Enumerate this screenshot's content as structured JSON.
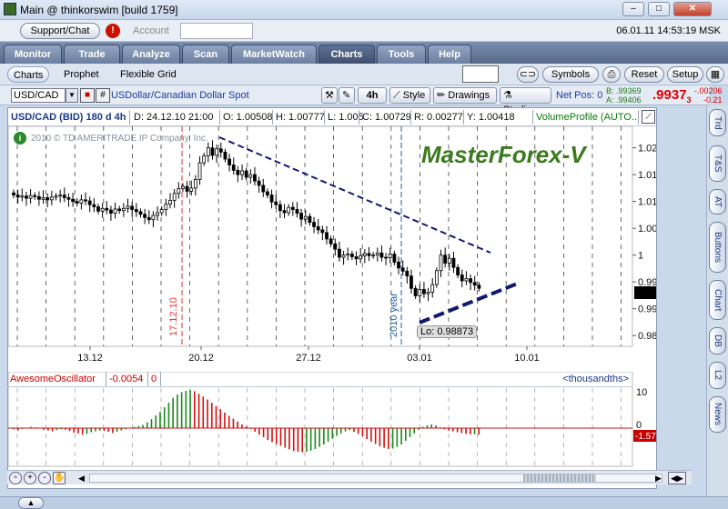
{
  "window": {
    "title": "Main @ thinkorswim [build 1759]",
    "minimize": "–",
    "maximize": "□",
    "close": "✕"
  },
  "toolbar": {
    "support_label": "Support/Chat",
    "alert_glyph": "!",
    "account_label": "Account",
    "account_value": "",
    "datetime": "06.01.11 14:53:19 MSK"
  },
  "main_tabs": [
    {
      "label": "Monitor"
    },
    {
      "label": "Trade"
    },
    {
      "label": "Analyze"
    },
    {
      "label": "Scan"
    },
    {
      "label": "MarketWatch"
    },
    {
      "label": "Charts",
      "active": true
    },
    {
      "label": "Tools"
    },
    {
      "label": "Help"
    }
  ],
  "sub_tabs": [
    {
      "label": "Charts",
      "active": true
    },
    {
      "label": "Prophet"
    },
    {
      "label": "Flexible Grid"
    }
  ],
  "sub_right": {
    "symbols": "Symbols",
    "reset": "Reset",
    "setup": "Setup"
  },
  "symbol_row": {
    "symbol": "USD/CAD",
    "hash": "#",
    "description": "USDollar/Canadian Dollar Spot",
    "timeframe": "4h",
    "style": "Style",
    "drawings": "Drawings",
    "studies": "Studies",
    "net_pos": "Net Pos: 0",
    "bid": "B: .99369",
    "ask": "A: .99406",
    "price": ".9937",
    "price_fraction": "3",
    "change_abs": "-.00206",
    "change_pct": "-0.21 %"
  },
  "chart_info": {
    "symbol": "USD/CAD (BID) 180 d 4h",
    "date": "D: 24.12.10 21:00",
    "open": "O: 1.00508",
    "high": "H: 1.00777",
    "low": "L: 1.005",
    "close": "C: 1.00729",
    "range": "R: 0.00277",
    "y": "Y: 1.00418",
    "volume_profile": "VolumeProfile (AUTO..."
  },
  "chart_overlay": {
    "copyright": "2010 © TD AMERITRADE IP Company, Inc.",
    "watermark": "MasterForex-V",
    "low_label": "Lo: 0.98873",
    "marker_1712": "17.12.10",
    "marker_year": "2010 year"
  },
  "right_tabs": [
    {
      "label": "Trd"
    },
    {
      "label": "T&S"
    },
    {
      "label": "AT"
    },
    {
      "label": "Buttons"
    },
    {
      "label": "Chart"
    },
    {
      "label": "DB"
    },
    {
      "label": "L2"
    },
    {
      "label": "News"
    }
  ],
  "oscillator": {
    "name": "AwesomeOscillator",
    "value": "-0.0054",
    "zero": "0",
    "units": "<thousandths>",
    "axis_top": "10",
    "axis_zero": "0",
    "current": "-1.5797"
  },
  "colors": {
    "bull": "#1a8a1a",
    "bear": "#d21010",
    "trend": "#101870",
    "marker": "#e03030",
    "yearline": "#2060a0"
  },
  "chart_data": {
    "type": "candlestick",
    "x_ticks": [
      "13.12",
      "20.12",
      "27.12",
      "03.01",
      "10.01"
    ],
    "y_ticks": [
      "1.02",
      "1.015",
      "1.01",
      "1.005",
      "1",
      "0.995",
      "0.99",
      "0.985"
    ],
    "ylim": [
      0.983,
      1.024
    ],
    "close_series": [
      1.0112,
      1.0108,
      1.011,
      1.0106,
      1.0111,
      1.0109,
      1.0104,
      1.0107,
      1.0103,
      1.0108,
      1.011,
      1.0112,
      1.0107,
      1.0104,
      1.01,
      1.0097,
      1.0103,
      1.0101,
      1.0094,
      1.009,
      1.0082,
      1.0087,
      1.0084,
      1.0078,
      1.0086,
      1.0083,
      1.0087,
      1.0091,
      1.0085,
      1.0081,
      1.0076,
      1.007,
      1.0066,
      1.0074,
      1.0079,
      1.0085,
      1.0095,
      1.0102,
      1.0115,
      1.0124,
      1.0128,
      1.0119,
      1.0125,
      1.0141,
      1.0172,
      1.0185,
      1.02,
      1.0186,
      1.0198,
      1.0192,
      1.0179,
      1.0168,
      1.0158,
      1.015,
      1.0157,
      1.0145,
      1.015,
      1.0138,
      1.013,
      1.0118,
      1.0112,
      1.0099,
      1.0094,
      1.0083,
      1.0079,
      1.0089,
      1.0085,
      1.0078,
      1.0067,
      1.0072,
      1.0061,
      1.0053,
      1.0047,
      1.0042,
      1.003,
      1.0021,
      1.0011,
      0.9996,
      1.0,
      1.0002,
      0.9997,
      0.9993,
      0.9999,
      1.0003,
      0.9999,
      1.0,
      1.0004,
      0.9996,
      0.9995,
      1.0002,
      0.9987,
      0.9976,
      0.997,
      0.9961,
      0.9938,
      0.9924,
      0.9936,
      0.9928,
      0.9931,
      0.9945,
      0.9971,
      1.0,
      0.9985,
      0.9994,
      0.9977,
      0.9963,
      0.9952,
      0.9956,
      0.9949,
      0.9944,
      0.9938
    ],
    "ao_values": [
      -0.3,
      -0.6,
      -0.2,
      0.1,
      0.3,
      0.2,
      -0.1,
      -0.4,
      -0.6,
      -0.8,
      -0.5,
      -0.3,
      -0.4,
      -0.7,
      -1.1,
      -1.3,
      -1.6,
      -1.4,
      -1.0,
      -0.8,
      -0.6,
      -0.7,
      -0.9,
      -1.2,
      -0.9,
      -0.6,
      -0.3,
      0.1,
      0.3,
      0.5,
      0.8,
      1.4,
      2.2,
      3.1,
      4.0,
      5.1,
      6.2,
      7.4,
      8.2,
      8.8,
      9.1,
      9.3,
      9.0,
      8.4,
      7.7,
      7.0,
      6.2,
      5.4,
      4.6,
      3.8,
      3.0,
      2.3,
      1.6,
      0.9,
      0.4,
      -0.2,
      -0.9,
      -1.6,
      -2.2,
      -2.9,
      -3.4,
      -3.9,
      -4.3,
      -4.8,
      -5.2,
      -5.6,
      -5.8,
      -5.9,
      -5.8,
      -5.5,
      -5.1,
      -4.6,
      -4.0,
      -3.3,
      -2.6,
      -1.9,
      -1.3,
      -0.8,
      -0.5,
      -0.9,
      -1.4,
      -2.0,
      -2.7,
      -3.3,
      -3.9,
      -4.4,
      -4.8,
      -5.1,
      -5.0,
      -4.6,
      -4.0,
      -3.1,
      -2.2,
      -1.3,
      -0.4,
      0.3,
      0.7,
      0.9,
      0.6,
      0.2,
      -0.3,
      -0.6,
      -0.8,
      -1.0,
      -1.2,
      -1.4,
      -1.5,
      -1.5,
      -1.6
    ]
  },
  "bottom_bar": {
    "zoom_out": "-",
    "zoom_in": "+",
    "hand": "✋",
    "collapse": "▲"
  }
}
